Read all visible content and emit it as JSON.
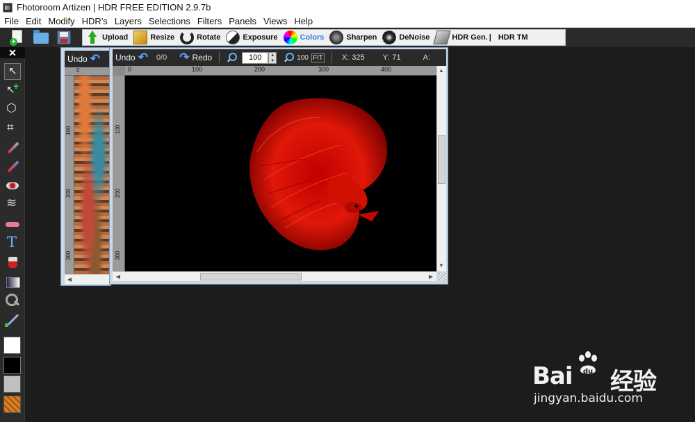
{
  "window": {
    "title": "Fhotoroom Artizen | HDR FREE EDITION 2.9.7b"
  },
  "menu": [
    "File",
    "Edit",
    "Modify",
    "HDR's",
    "Layers",
    "Selections",
    "Filters",
    "Panels",
    "Views",
    "Help"
  ],
  "toolbar": {
    "file_buttons": [
      "new-file-icon",
      "open-folder-icon",
      "save-disk-icon"
    ],
    "upload": "Upload",
    "resize": "Resize",
    "rotate": "Rotate",
    "exposure": "Exposure",
    "colors": "Colors",
    "sharpen": "Sharpen",
    "denoise": "DeNoise",
    "hdr_gen": "HDR Gen.",
    "separator": "|",
    "hdr_tm": "HDR TM",
    "colors_accent": "#2b7de0"
  },
  "close_strip": {
    "label": "✕"
  },
  "tools": [
    "select-arrow-icon",
    "add-selection-icon",
    "lasso-icon",
    "crop-icon",
    "brush-icon",
    "pencil-icon",
    "red-eye-icon",
    "smudge-icon",
    "eraser-icon",
    "text-icon",
    "fill-bucket-icon",
    "gradient-icon",
    "zoom-icon",
    "color-picker-icon"
  ],
  "swatches": {
    "primary": "#ffffff",
    "secondary": "#000000",
    "tertiary": "#c0c0c0",
    "texture": "orange-texture"
  },
  "layers_panel": {
    "undo_label": "Undo",
    "ruler_top": "0",
    "ruler_left": [
      "100",
      "200",
      "300"
    ]
  },
  "image_window": {
    "undo_label": "Undo",
    "undo_counter": "0/0",
    "redo_label": "Redo",
    "zoom_value": "100",
    "zoom_100": "100",
    "zoom_fit": "FIT",
    "x_label": "X:",
    "x_value": "325",
    "y_label": "Y:",
    "y_value": "71",
    "a_label": "A:",
    "ruler_top": [
      "0",
      "100",
      "200",
      "300",
      "400"
    ],
    "ruler_left": [
      "100",
      "200",
      "300"
    ]
  },
  "watermark": {
    "brand_left": "Bai",
    "brand_right": "经验",
    "url": "jingyan.baidu.com"
  }
}
